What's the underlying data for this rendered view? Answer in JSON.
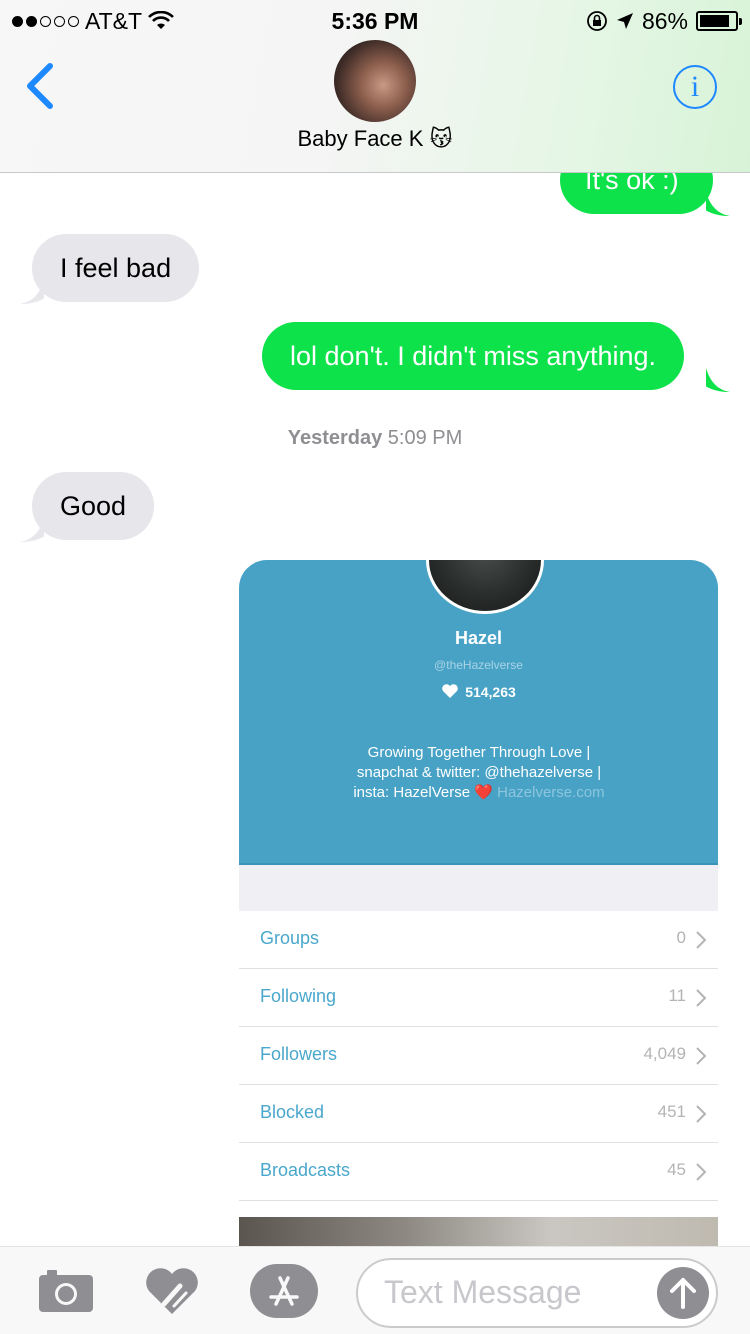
{
  "status_bar": {
    "carrier": "AT&T",
    "time": "5:36 PM",
    "battery": "86%",
    "battery_level": 0.86,
    "signal_bars": 2
  },
  "header": {
    "contact_name": "Baby Face K 😽",
    "info_label": "i"
  },
  "messages": {
    "m1": "It's ok :)",
    "m2": "I feel bad",
    "m3": "lol don't. I didn't miss anything.",
    "timestamp_day": "Yesterday",
    "timestamp_time": "5:09 PM",
    "m4": "Good"
  },
  "card": {
    "name": "Hazel",
    "handle": "@theHazelverse",
    "likes": "514,263",
    "bio_line1": "Growing Together Through Love |",
    "bio_line2": "snapchat & twitter: @thehazelverse |",
    "bio_line3": "insta: HazelVerse",
    "bio_heart": "❤️",
    "bio_link": "Hazelverse.com",
    "rows": [
      {
        "label": "Groups",
        "count": "0"
      },
      {
        "label": "Following",
        "count": "11"
      },
      {
        "label": "Followers",
        "count": "4,049"
      },
      {
        "label": "Blocked",
        "count": "451"
      },
      {
        "label": "Broadcasts",
        "count": "45"
      }
    ]
  },
  "input": {
    "placeholder": "Text Message"
  },
  "colors": {
    "sent_bubble": "#0ee24a",
    "received_bubble": "#e6e6eb",
    "ios_blue": "#1e88ff",
    "card_blue": "#47a2c6"
  },
  "icons": [
    "chevron-left-icon",
    "info-icon",
    "camera-icon",
    "digital-touch-icon",
    "app-store-icon",
    "send-arrow-icon",
    "heart-icon",
    "wifi-icon",
    "location-arrow-icon",
    "rotation-lock-icon",
    "battery-icon"
  ]
}
